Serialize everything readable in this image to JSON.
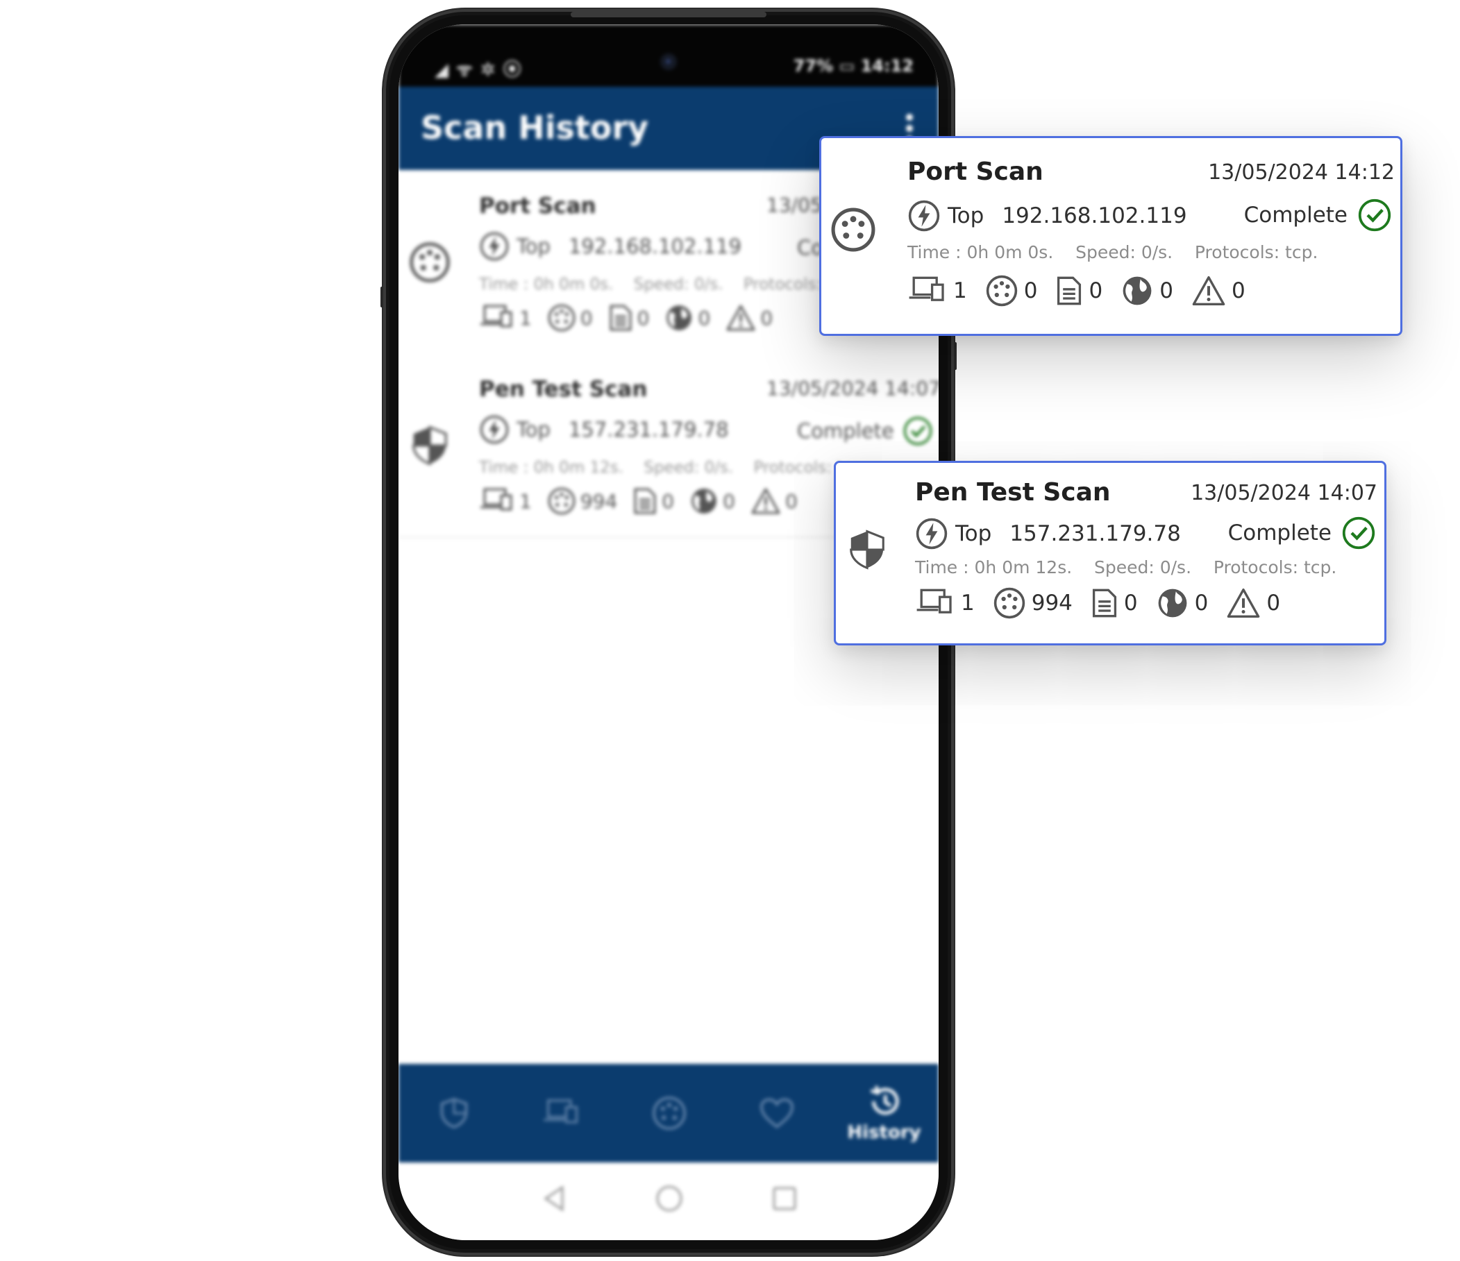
{
  "status_bar": {
    "left": "◢ ᯤ ✲ ⦿",
    "right": "77% ▭ 14:12"
  },
  "app_bar": {
    "title": "Scan History"
  },
  "scans": [
    {
      "name": "Port Scan",
      "date": "13/05/2024 14:12",
      "mode": "Top",
      "target": "192.168.102.119",
      "status": "Complete",
      "time_text": "Time : 0h 0m 0s.",
      "speed_text": "Speed: 0/s.",
      "protocols_text": "Protocols: tcp.",
      "devices": "1",
      "ports": "0",
      "files": "0",
      "web": "0",
      "vulns": "0"
    },
    {
      "name": "Pen Test Scan",
      "date": "13/05/2024 14:07",
      "mode": "Top",
      "target": "157.231.179.78",
      "status": "Complete",
      "time_text": "Time : 0h 0m 12s.",
      "speed_text": "Speed: 0/s.",
      "protocols_text": "Protocols: tcp.",
      "devices": "1",
      "ports": "994",
      "files": "0",
      "web": "0",
      "vulns": "0"
    }
  ],
  "bottom_nav": {
    "history_label": "History"
  },
  "colors": {
    "primary": "#0b3c6e",
    "accent_border": "#4f6fe0",
    "success": "#1e7a1e"
  },
  "icons": {
    "port_scan": "port-icon",
    "pen_test": "shield-icon",
    "mode": "lightning-icon",
    "status": "check-circle-icon",
    "devices": "devices-icon",
    "ports": "port-icon",
    "files": "document-icon",
    "web": "globe-icon",
    "vulns": "warning-icon"
  }
}
